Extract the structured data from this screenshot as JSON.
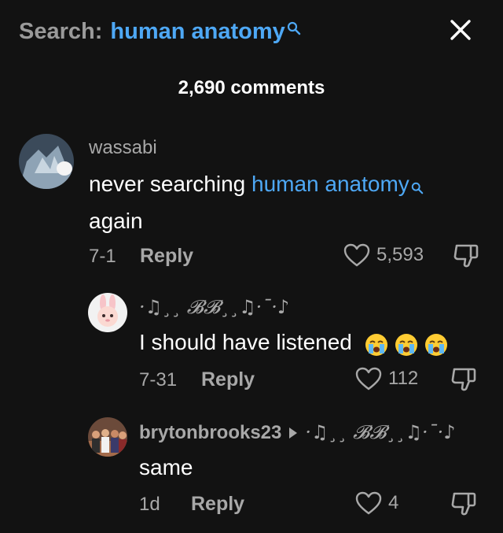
{
  "header": {
    "search_prefix": "Search:",
    "search_term": "human anatomy"
  },
  "comment_count": "2,690 comments",
  "comments": [
    {
      "username": "wassabi",
      "text_before": "never searching ",
      "highlight": "human anatomy",
      "text_after": "again",
      "date": "7-1",
      "reply_label": "Reply",
      "likes": "5,593"
    },
    {
      "username": "·♫¸¸ 𝓑𝓑¸¸♫·¯·♪",
      "text": "I should have listened",
      "emojis": [
        "loudly-crying-face",
        "loudly-crying-face",
        "loudly-crying-face"
      ],
      "date": "7-31",
      "reply_label": "Reply",
      "likes": "112"
    },
    {
      "username": "brytonbrooks23",
      "reply_to": "·♫¸¸ 𝓑𝓑¸¸♫·¯·♪",
      "text": "same",
      "date": "1d",
      "reply_label": "Reply",
      "likes": "4"
    }
  ],
  "colors": {
    "background": "#121212",
    "link": "#4ea8f5",
    "muted": "#a8a8a8"
  }
}
